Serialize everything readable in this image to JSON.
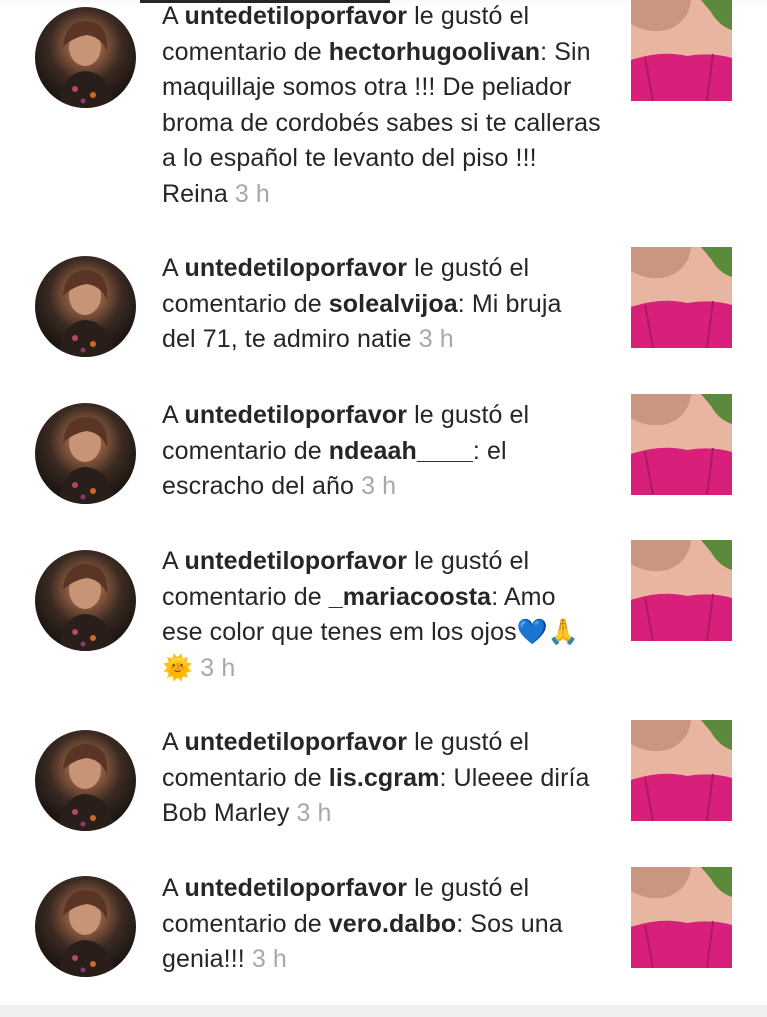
{
  "notifications": [
    {
      "actor": "untedetiloporfavor",
      "action": " le gustó el comentario de ",
      "commenter": "hectorhugoolivan",
      "comment": ": Sin maquillaje somos otra !!! De peliador broma de cordobés sabes si te calleras a lo español te levanto del piso !!! Reina ",
      "time": "3 h"
    },
    {
      "actor": "untedetiloporfavor",
      "action": " le gustó el comentario de ",
      "commenter": "solealvijoa",
      "comment": ": Mi bruja del 71, te admiro natie ",
      "time": "3 h"
    },
    {
      "actor": "untedetiloporfavor",
      "action": " le gustó el comentario de ",
      "commenter": "ndeaah____",
      "comment": ": el escracho del año ",
      "time": "3 h"
    },
    {
      "actor": "untedetiloporfavor",
      "action": " le gustó el comentario de ",
      "commenter": "_mariacoosta",
      "comment": ": Amo ese color que tenes em los ojos💙🙏🌞 ",
      "time": "3 h"
    },
    {
      "actor": "untedetiloporfavor",
      "action": " le gustó el comentario de ",
      "commenter": "lis.cgram",
      "comment": ": Uleeee diría Bob Marley ",
      "time": "3 h"
    },
    {
      "actor": "untedetiloporfavor",
      "action": " le gustó el comentario de ",
      "commenter": "vero.dalbo",
      "comment": ": Sos una genia!!! ",
      "time": "3 h"
    }
  ]
}
